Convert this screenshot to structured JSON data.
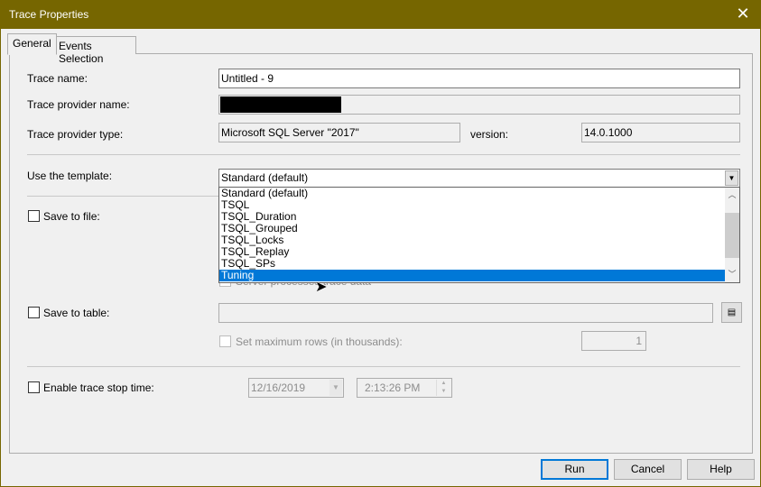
{
  "window": {
    "title": "Trace Properties"
  },
  "tabs": [
    {
      "label": "General"
    },
    {
      "label": "Events Selection"
    }
  ],
  "general": {
    "trace_name_label": "Trace name:",
    "trace_name_value": "Untitled - 9",
    "provider_name_label": "Trace provider name:",
    "provider_type_label": "Trace provider type:",
    "provider_type_value": "Microsoft SQL Server \"2017\"",
    "version_label": "version:",
    "version_value": "14.0.1000",
    "template_label": "Use the template:",
    "template_value": "Standard (default)",
    "template_options": [
      "Standard (default)",
      "TSQL",
      "TSQL_Duration",
      "TSQL_Grouped",
      "TSQL_Locks",
      "TSQL_Replay",
      "TSQL_SPs",
      "Tuning"
    ],
    "template_highlighted": "Tuning",
    "save_file_label": "Save to file:",
    "server_processes_label": "Server processes trace data",
    "save_table_label": "Save to table:",
    "max_rows_label": "Set maximum rows (in thousands):",
    "max_rows_value": "1",
    "stop_time_label": "Enable trace stop time:",
    "stop_date": "12/16/2019",
    "stop_time": "2:13:26 PM"
  },
  "buttons": {
    "run": "Run",
    "cancel": "Cancel",
    "help": "Help"
  },
  "colors": {
    "titlebar": "#766600",
    "selection": "#0078d7"
  }
}
